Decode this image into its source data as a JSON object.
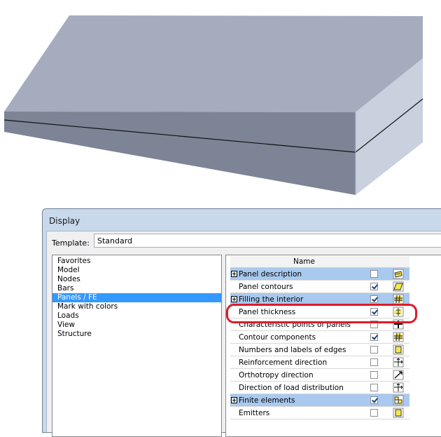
{
  "dialog": {
    "title": "Display",
    "template_label": "Template:",
    "template_value": "Standard",
    "categories": [
      "Favorites",
      "Model",
      "Nodes",
      "Bars",
      "Panels / FE",
      "Mark with colors",
      "Loads",
      "View",
      "Structure"
    ],
    "selected_category": "Panels / FE",
    "grid_header": "Name",
    "rows": [
      {
        "label": "Panel description",
        "checked": false,
        "group": true,
        "icon": "panel-description-icon"
      },
      {
        "label": "Panel contours",
        "checked": true,
        "group": false,
        "icon": "panel-contour-icon"
      },
      {
        "label": "Filling the interior",
        "checked": true,
        "group": true,
        "icon": "hatch-icon"
      },
      {
        "label": "Panel thickness",
        "checked": true,
        "group": false,
        "icon": "thickness-icon"
      },
      {
        "label": "Characteristic points of panels",
        "checked": false,
        "group": false,
        "icon": "cross-icon"
      },
      {
        "label": "Contour components",
        "checked": true,
        "group": false,
        "icon": "hatch-icon"
      },
      {
        "label": "Numbers and labels of edges",
        "checked": false,
        "group": false,
        "icon": "square-icon"
      },
      {
        "label": "Reinforcement direction",
        "checked": false,
        "group": false,
        "icon": "arrows-icon"
      },
      {
        "label": "Orthotropy direction",
        "checked": false,
        "group": false,
        "icon": "diagonal-arrow-icon"
      },
      {
        "label": "Direction of load distribution",
        "checked": false,
        "group": false,
        "icon": "arrows-icon"
      },
      {
        "label": "Finite elements",
        "checked": true,
        "group": true,
        "icon": "mesh-icon"
      },
      {
        "label": "Emitters",
        "checked": false,
        "group": false,
        "icon": "square-icon"
      }
    ]
  },
  "colors": {
    "selection": "#3399ff",
    "group_row": "#a9c9ee",
    "highlight": "#dd1c2a",
    "icon_yellow": "#f6e84a"
  }
}
